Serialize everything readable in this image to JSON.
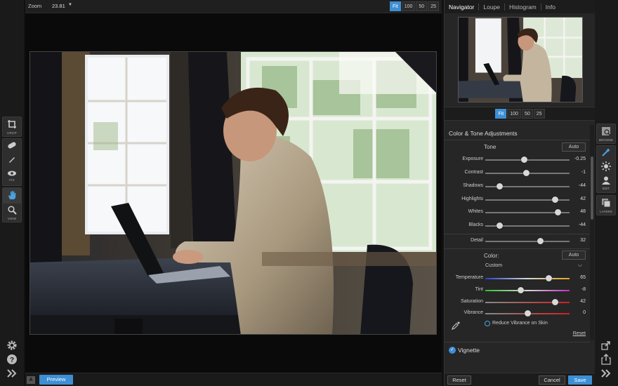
{
  "left_tools": {
    "crop": {
      "icon": "crop-icon",
      "label": "CROP"
    },
    "fix": {
      "label": "FIX",
      "icons": [
        "bandage-icon",
        "brush-icon",
        "eye-icon"
      ]
    },
    "view": {
      "label": "VIEW",
      "icons": [
        "hand-icon",
        "zoom-icon"
      ]
    },
    "bottom": [
      "gear-icon",
      "help-icon",
      "collapse-left-icon"
    ]
  },
  "canvas": {
    "zoom_label": "Zoom",
    "zoom_value": "23.81",
    "zoom_buttons": [
      "Fit",
      "100",
      "50",
      "25"
    ],
    "zoom_selected": "Fit",
    "ab_label": "A",
    "preview_label": "Preview"
  },
  "panel": {
    "tabs": [
      "Navigator",
      "Loupe",
      "Histogram",
      "Info"
    ],
    "active_tab": "Navigator",
    "nav_zoom_buttons": [
      "Fit",
      "100",
      "50",
      "25"
    ],
    "nav_zoom_selected": "Fit",
    "section_title": "Color & Tone Adjustments",
    "tone": {
      "title": "Tone",
      "auto_label": "Auto",
      "sliders": [
        {
          "label": "Exposure",
          "value": "-0.25",
          "position": 0.46
        },
        {
          "label": "Contrast",
          "value": "-1",
          "position": 0.49
        },
        {
          "label": "Shadows",
          "value": "-44",
          "position": 0.17
        },
        {
          "label": "Highlights",
          "value": "42",
          "position": 0.83
        },
        {
          "label": "Whites",
          "value": "48",
          "position": 0.86
        },
        {
          "label": "Blacks",
          "value": "-44",
          "position": 0.17
        }
      ],
      "detail": {
        "label": "Detail",
        "value": "32",
        "position": 0.65
      }
    },
    "color": {
      "title": "Color:",
      "auto_label": "Auto",
      "preset": "Custom",
      "sliders": [
        {
          "label": "Temperature",
          "value": "65",
          "position": 0.75
        },
        {
          "label": "Tint",
          "value": "-8",
          "position": 0.42
        },
        {
          "label": "Saturation",
          "value": "42",
          "position": 0.83
        },
        {
          "label": "Vibrance",
          "value": "0",
          "position": 0.5
        }
      ],
      "reduce_vibrance_label": "Reduce Vibrance on Skin",
      "reset_label": "Reset"
    },
    "vignette_label": "Vignette",
    "bottom": {
      "reset": "Reset",
      "cancel": "Cancel",
      "save": "Save"
    }
  },
  "right_modules": {
    "browse": "BROWSE",
    "edit": "EDIT",
    "layers": "LAYERS",
    "bottom": [
      "export-icon",
      "share-icon",
      "collapse-right-icon"
    ]
  },
  "colors": {
    "accent": "#3d8fd4"
  }
}
